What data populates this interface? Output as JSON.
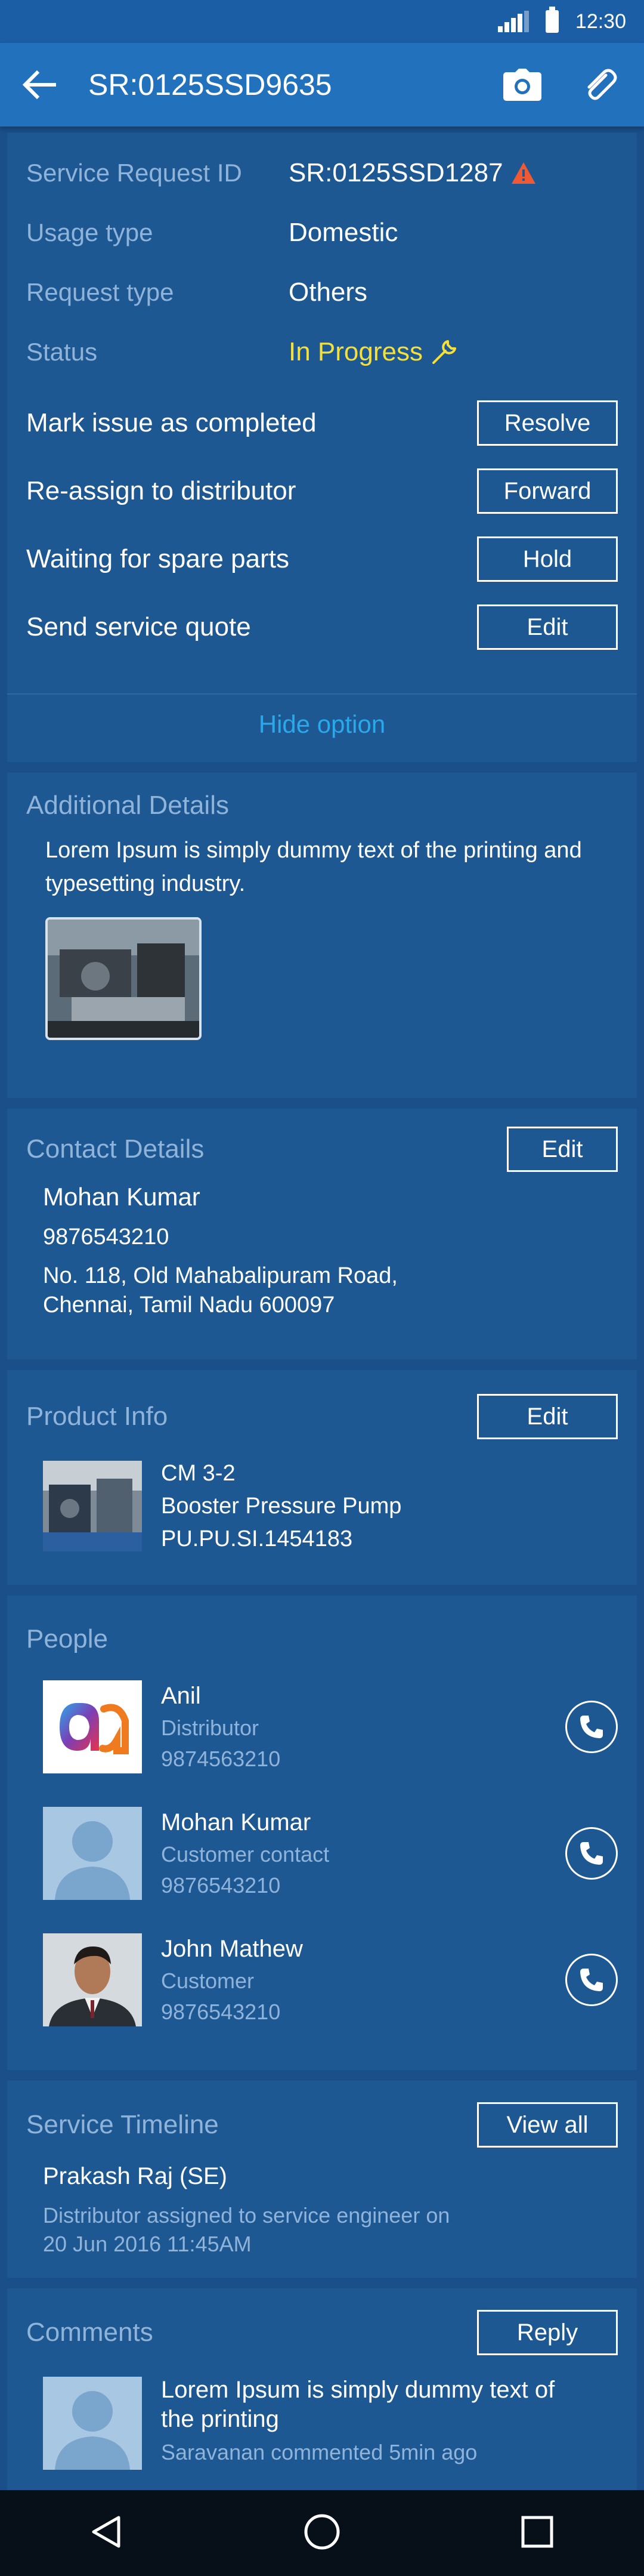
{
  "status_bar": {
    "time": "12:30"
  },
  "app_bar": {
    "title": "SR:0125SSD9635"
  },
  "request": {
    "fields": [
      {
        "label": "Service Request ID",
        "value": "SR:0125SSD1287"
      },
      {
        "label": "Usage type",
        "value": "Domestic"
      },
      {
        "label": "Request type",
        "value": "Others"
      },
      {
        "label": "Status",
        "value": "In Progress"
      }
    ],
    "status_color": "#f4df3b",
    "actions": [
      {
        "label": "Mark issue as completed",
        "button": "Resolve"
      },
      {
        "label": "Re-assign to distributor",
        "button": "Forward"
      },
      {
        "label": "Waiting for spare parts",
        "button": "Hold"
      },
      {
        "label": "Send service quote",
        "button": "Edit"
      }
    ],
    "toggle": "Hide option"
  },
  "additional": {
    "title": "Additional Details",
    "text": "Lorem Ipsum is simply dummy text of the printing and typesetting industry."
  },
  "contact": {
    "title": "Contact Details",
    "edit": "Edit",
    "name": "Mohan Kumar",
    "phone": "9876543210",
    "address_line1": "No. 118, Old Mahabalipuram Road,",
    "address_line2": "Chennai, Tamil Nadu 600097"
  },
  "product": {
    "title": "Product Info",
    "edit": "Edit",
    "model": "CM 3-2",
    "name": "Booster Pressure Pump",
    "code": "PU.PU.SI.1454183"
  },
  "people": {
    "title": "People",
    "list": [
      {
        "name": "Anil",
        "role": "Distributor",
        "phone": "9874563210"
      },
      {
        "name": "Mohan Kumar",
        "role": "Customer contact",
        "phone": "9876543210"
      },
      {
        "name": "John Mathew",
        "role": "Customer",
        "phone": "9876543210"
      }
    ]
  },
  "timeline": {
    "title": "Service Timeline",
    "view_all": "View all",
    "person": "Prakash Raj (SE)",
    "event_line1": "Distributor assigned to service engineer on",
    "event_line2": "20 Jun 2016 11:45AM"
  },
  "comments": {
    "title": "Comments",
    "reply": "Reply",
    "text_line1": "Lorem Ipsum is simply dummy text of",
    "text_line2": "the printing",
    "meta": "Saravanan commented 5min ago"
  },
  "colors": {
    "accent": "#2271bd",
    "link": "#2aa8ea",
    "warning": "#ef5a35"
  }
}
